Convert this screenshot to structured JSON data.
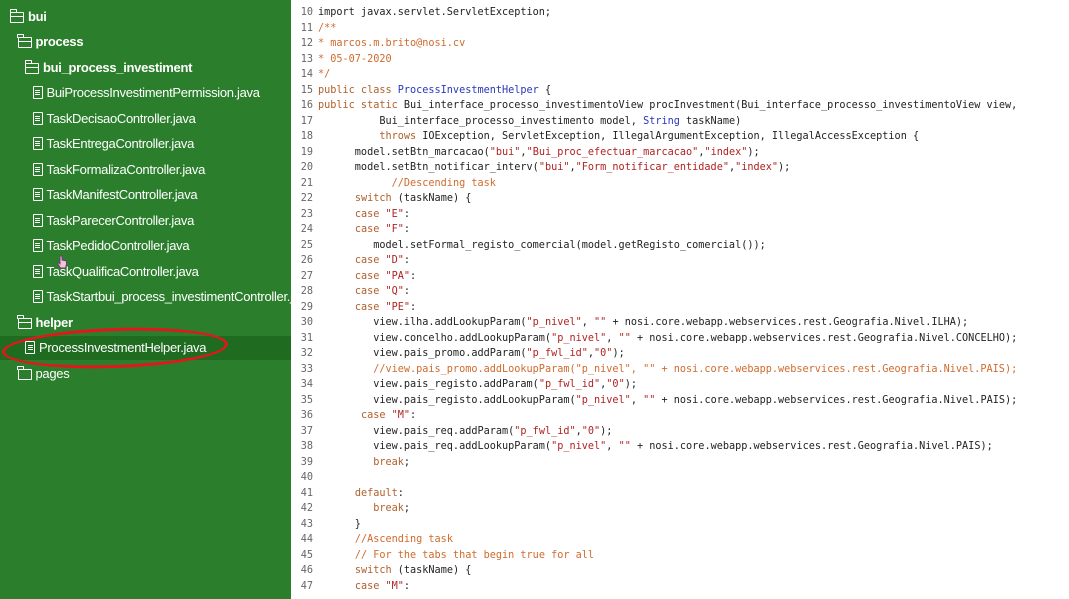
{
  "sidebar": {
    "items": [
      {
        "label": "bui",
        "kind": "folder-open",
        "indent": 0,
        "bold": true
      },
      {
        "label": "process",
        "kind": "folder-open",
        "indent": 1,
        "bold": true
      },
      {
        "label": "bui_process_investiment",
        "kind": "folder-open",
        "indent": 2,
        "bold": true
      },
      {
        "label": "BuiProcessInvestimentPermission.java",
        "kind": "file",
        "indent": 3,
        "bold": false
      },
      {
        "label": "TaskDecisaoController.java",
        "kind": "file",
        "indent": 3,
        "bold": false
      },
      {
        "label": "TaskEntregaController.java",
        "kind": "file",
        "indent": 3,
        "bold": false
      },
      {
        "label": "TaskFormalizaController.java",
        "kind": "file",
        "indent": 3,
        "bold": false
      },
      {
        "label": "TaskManifestController.java",
        "kind": "file",
        "indent": 3,
        "bold": false
      },
      {
        "label": "TaskParecerController.java",
        "kind": "file",
        "indent": 3,
        "bold": false
      },
      {
        "label": "TaskPedidoController.java",
        "kind": "file",
        "indent": 3,
        "bold": false
      },
      {
        "label": "TaskQualificaController.java",
        "kind": "file",
        "indent": 3,
        "bold": false
      },
      {
        "label": "TaskStartbui_process_investimentController.j...",
        "kind": "file",
        "indent": 3,
        "bold": false
      },
      {
        "label": "helper",
        "kind": "folder-open",
        "indent": 1,
        "bold": true
      },
      {
        "label": "ProcessInvestmentHelper.java",
        "kind": "file",
        "indent": 2,
        "bold": false,
        "selected": true
      },
      {
        "label": "pages",
        "kind": "folder",
        "indent": 1,
        "bold": false
      }
    ]
  },
  "colors": {
    "sidebar_bg": "#2b7f2c",
    "selected_bg": "#1f6b20",
    "annotation": "#e4161b",
    "keyword": "#b0602b",
    "string": "#b02222",
    "comment": "#d06b2e",
    "type": "#2a37b8"
  },
  "editor": {
    "lines": [
      {
        "n": "10",
        "tokens": [
          {
            "t": "import javax.servlet.ServletException;"
          }
        ]
      },
      {
        "n": "11",
        "tokens": [
          {
            "t": "/**",
            "c": "cm"
          }
        ]
      },
      {
        "n": "12",
        "tokens": [
          {
            "t": "* marcos.m.brito@nosi.cv",
            "c": "cm"
          }
        ]
      },
      {
        "n": "13",
        "tokens": [
          {
            "t": "* 05-07-2020",
            "c": "cm"
          }
        ]
      },
      {
        "n": "14",
        "tokens": [
          {
            "t": "*/",
            "c": "cm"
          }
        ]
      },
      {
        "n": "15",
        "tokens": [
          {
            "t": "public class ",
            "c": "kw"
          },
          {
            "t": "ProcessInvestmentHelper",
            "c": "ty"
          },
          {
            "t": " {"
          }
        ]
      },
      {
        "n": "16",
        "tokens": [
          {
            "t": "public static ",
            "c": "kw"
          },
          {
            "t": "Bui_interface_processo_investimentoView procInvestment(Bui_interface_processo_investimentoView view,"
          }
        ]
      },
      {
        "n": "17",
        "tokens": [
          {
            "t": "          Bui_interface_processo_investimento model, "
          },
          {
            "t": "String",
            "c": "ty"
          },
          {
            "t": " taskName)"
          }
        ]
      },
      {
        "n": "18",
        "tokens": [
          {
            "t": "          "
          },
          {
            "t": "throws",
            "c": "kw"
          },
          {
            "t": " IOException, ServletException, IllegalArgumentException, IllegalAccessException {"
          }
        ]
      },
      {
        "n": "19",
        "tokens": [
          {
            "t": "      model.setBtn_marcacao("
          },
          {
            "t": "\"bui\"",
            "c": "str"
          },
          {
            "t": ","
          },
          {
            "t": "\"Bui_proc_efectuar_marcacao\"",
            "c": "str"
          },
          {
            "t": ","
          },
          {
            "t": "\"index\"",
            "c": "str"
          },
          {
            "t": ");"
          }
        ]
      },
      {
        "n": "20",
        "tokens": [
          {
            "t": "      model.setBtn_notificar_interv("
          },
          {
            "t": "\"bui\"",
            "c": "str"
          },
          {
            "t": ","
          },
          {
            "t": "\"Form_notificar_entidade\"",
            "c": "str"
          },
          {
            "t": ","
          },
          {
            "t": "\"index\"",
            "c": "str"
          },
          {
            "t": ");"
          }
        ]
      },
      {
        "n": "21",
        "tokens": [
          {
            "t": "            "
          },
          {
            "t": "//Descending task",
            "c": "cm"
          }
        ]
      },
      {
        "n": "22",
        "tokens": [
          {
            "t": "      "
          },
          {
            "t": "switch",
            "c": "kw"
          },
          {
            "t": " (taskName) {"
          }
        ]
      },
      {
        "n": "23",
        "tokens": [
          {
            "t": "      "
          },
          {
            "t": "case",
            "c": "kw"
          },
          {
            "t": " "
          },
          {
            "t": "\"E\"",
            "c": "str"
          },
          {
            "t": ":"
          }
        ]
      },
      {
        "n": "24",
        "tokens": [
          {
            "t": "      "
          },
          {
            "t": "case",
            "c": "kw"
          },
          {
            "t": " "
          },
          {
            "t": "\"F\"",
            "c": "str"
          },
          {
            "t": ":"
          }
        ]
      },
      {
        "n": "25",
        "tokens": [
          {
            "t": "         model.setFormal_registo_comercial(model.getRegisto_comercial());"
          }
        ]
      },
      {
        "n": "26",
        "tokens": [
          {
            "t": "      "
          },
          {
            "t": "case",
            "c": "kw"
          },
          {
            "t": " "
          },
          {
            "t": "\"D\"",
            "c": "str"
          },
          {
            "t": ":"
          }
        ]
      },
      {
        "n": "27",
        "tokens": [
          {
            "t": "      "
          },
          {
            "t": "case",
            "c": "kw"
          },
          {
            "t": " "
          },
          {
            "t": "\"PA\"",
            "c": "str"
          },
          {
            "t": ":"
          }
        ]
      },
      {
        "n": "28",
        "tokens": [
          {
            "t": "      "
          },
          {
            "t": "case",
            "c": "kw"
          },
          {
            "t": " "
          },
          {
            "t": "\"Q\"",
            "c": "str"
          },
          {
            "t": ":"
          }
        ]
      },
      {
        "n": "29",
        "tokens": [
          {
            "t": "      "
          },
          {
            "t": "case",
            "c": "kw"
          },
          {
            "t": " "
          },
          {
            "t": "\"PE\"",
            "c": "str"
          },
          {
            "t": ":"
          }
        ]
      },
      {
        "n": "30",
        "tokens": [
          {
            "t": "         view.ilha.addLookupParam("
          },
          {
            "t": "\"p_nivel\"",
            "c": "str"
          },
          {
            "t": ", "
          },
          {
            "t": "\"\"",
            "c": "str"
          },
          {
            "t": " + nosi.core.webapp.webservices.rest.Geografia.Nivel.ILHA);"
          }
        ]
      },
      {
        "n": "31",
        "tokens": [
          {
            "t": "         view.concelho.addLookupParam("
          },
          {
            "t": "\"p_nivel\"",
            "c": "str"
          },
          {
            "t": ", "
          },
          {
            "t": "\"\"",
            "c": "str"
          },
          {
            "t": " + nosi.core.webapp.webservices.rest.Geografia.Nivel.CONCELHO);"
          }
        ]
      },
      {
        "n": "32",
        "tokens": [
          {
            "t": "         view.pais_promo.addParam("
          },
          {
            "t": "\"p_fwl_id\"",
            "c": "str"
          },
          {
            "t": ","
          },
          {
            "t": "\"0\"",
            "c": "str"
          },
          {
            "t": ");"
          }
        ]
      },
      {
        "n": "33",
        "tokens": [
          {
            "t": "         "
          },
          {
            "t": "//view.pais_promo.addLookupParam(\"p_nivel\", \"\" + nosi.core.webapp.webservices.rest.Geografia.Nivel.PAIS);",
            "c": "cm"
          }
        ]
      },
      {
        "n": "34",
        "tokens": [
          {
            "t": "         view.pais_registo.addParam("
          },
          {
            "t": "\"p_fwl_id\"",
            "c": "str"
          },
          {
            "t": ","
          },
          {
            "t": "\"0\"",
            "c": "str"
          },
          {
            "t": ");"
          }
        ]
      },
      {
        "n": "35",
        "tokens": [
          {
            "t": "         view.pais_registo.addLookupParam("
          },
          {
            "t": "\"p_nivel\"",
            "c": "str"
          },
          {
            "t": ", "
          },
          {
            "t": "\"\"",
            "c": "str"
          },
          {
            "t": " + nosi.core.webapp.webservices.rest.Geografia.Nivel.PAIS);"
          }
        ]
      },
      {
        "n": "36",
        "tokens": [
          {
            "t": "       "
          },
          {
            "t": "case",
            "c": "kw"
          },
          {
            "t": " "
          },
          {
            "t": "\"M\"",
            "c": "str"
          },
          {
            "t": ":"
          }
        ]
      },
      {
        "n": "37",
        "tokens": [
          {
            "t": "         view.pais_req.addParam("
          },
          {
            "t": "\"p_fwl_id\"",
            "c": "str"
          },
          {
            "t": ","
          },
          {
            "t": "\"0\"",
            "c": "str"
          },
          {
            "t": ");"
          }
        ]
      },
      {
        "n": "38",
        "tokens": [
          {
            "t": "         view.pais_req.addLookupParam("
          },
          {
            "t": "\"p_nivel\"",
            "c": "str"
          },
          {
            "t": ", "
          },
          {
            "t": "\"\"",
            "c": "str"
          },
          {
            "t": " + nosi.core.webapp.webservices.rest.Geografia.Nivel.PAIS);"
          }
        ]
      },
      {
        "n": "39",
        "tokens": [
          {
            "t": "         "
          },
          {
            "t": "break",
            "c": "kw"
          },
          {
            "t": ";"
          }
        ]
      },
      {
        "n": "40",
        "tokens": [
          {
            "t": ""
          }
        ]
      },
      {
        "n": "41",
        "tokens": [
          {
            "t": "      "
          },
          {
            "t": "default",
            "c": "kw"
          },
          {
            "t": ":"
          }
        ]
      },
      {
        "n": "42",
        "tokens": [
          {
            "t": "         "
          },
          {
            "t": "break",
            "c": "kw"
          },
          {
            "t": ";"
          }
        ]
      },
      {
        "n": "43",
        "tokens": [
          {
            "t": "      }"
          }
        ]
      },
      {
        "n": "44",
        "tokens": [
          {
            "t": "      "
          },
          {
            "t": "//Ascending task",
            "c": "cm"
          }
        ]
      },
      {
        "n": "45",
        "tokens": [
          {
            "t": "      "
          },
          {
            "t": "// For the tabs that begin true for all",
            "c": "cm"
          }
        ]
      },
      {
        "n": "46",
        "tokens": [
          {
            "t": "      "
          },
          {
            "t": "switch",
            "c": "kw"
          },
          {
            "t": " (taskName) {"
          }
        ]
      },
      {
        "n": "47",
        "tokens": [
          {
            "t": "      "
          },
          {
            "t": "case",
            "c": "kw"
          },
          {
            "t": " "
          },
          {
            "t": "\"M\"",
            "c": "str"
          },
          {
            "t": ":"
          }
        ]
      }
    ]
  }
}
